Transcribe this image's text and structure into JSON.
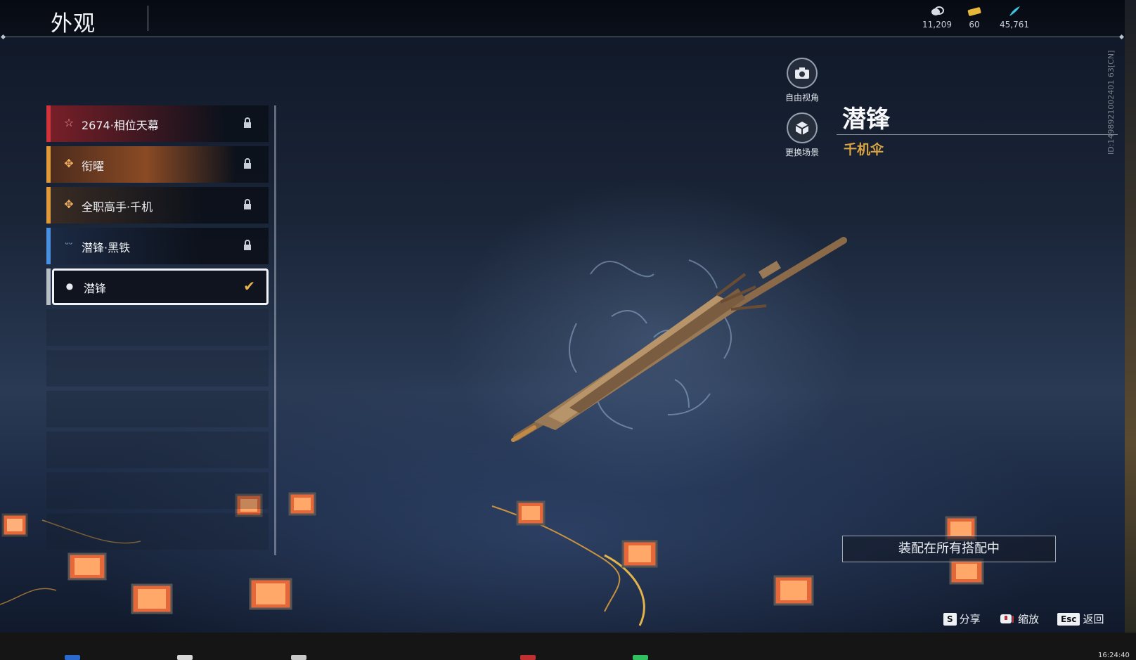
{
  "header": {
    "title": "外观"
  },
  "currencies": [
    {
      "icon": "coin-stack-icon",
      "value": "11,209",
      "color": "#d8dde5"
    },
    {
      "icon": "ticket-icon",
      "value": "60",
      "color": "#e8b83a"
    },
    {
      "icon": "feather-icon",
      "value": "45,761",
      "color": "#3cc6e0"
    }
  ],
  "side_id": "ID:1498921002401 63[CN]",
  "skins": [
    {
      "label": "2674·相位天幕",
      "icon": "star-icon",
      "bar_color": "#d0343a",
      "locked": true,
      "selected": false,
      "tint": "#7a1f28"
    },
    {
      "label": "衔曜",
      "icon": "flower-icon",
      "bar_color": "#e09a3a",
      "locked": true,
      "selected": false,
      "tint": "#8a4a24"
    },
    {
      "label": "全职高手·千机",
      "icon": "flower-icon",
      "bar_color": "#e09a3a",
      "locked": true,
      "selected": false,
      "tint": "#3a2c24"
    },
    {
      "label": "潜锋·黑铁",
      "icon": "wings-icon",
      "bar_color": "#4a90e0",
      "locked": true,
      "selected": false,
      "tint": "#1c2a44"
    },
    {
      "label": "潜锋",
      "icon": "drop-icon",
      "bar_color": "#b8bec8",
      "locked": false,
      "selected": true,
      "tint": "#0e121c"
    }
  ],
  "camera": {
    "free_view": "自由视角",
    "change_scene": "更换场景"
  },
  "item": {
    "name": "潜锋",
    "type": "千机伞"
  },
  "equip_all": "装配在所有搭配中",
  "hints": {
    "share_key": "S",
    "share": "分享",
    "zoom": "缩放",
    "back_key": "Esc",
    "back": "返回"
  },
  "taskbar": {
    "clock": "16:24:40"
  }
}
